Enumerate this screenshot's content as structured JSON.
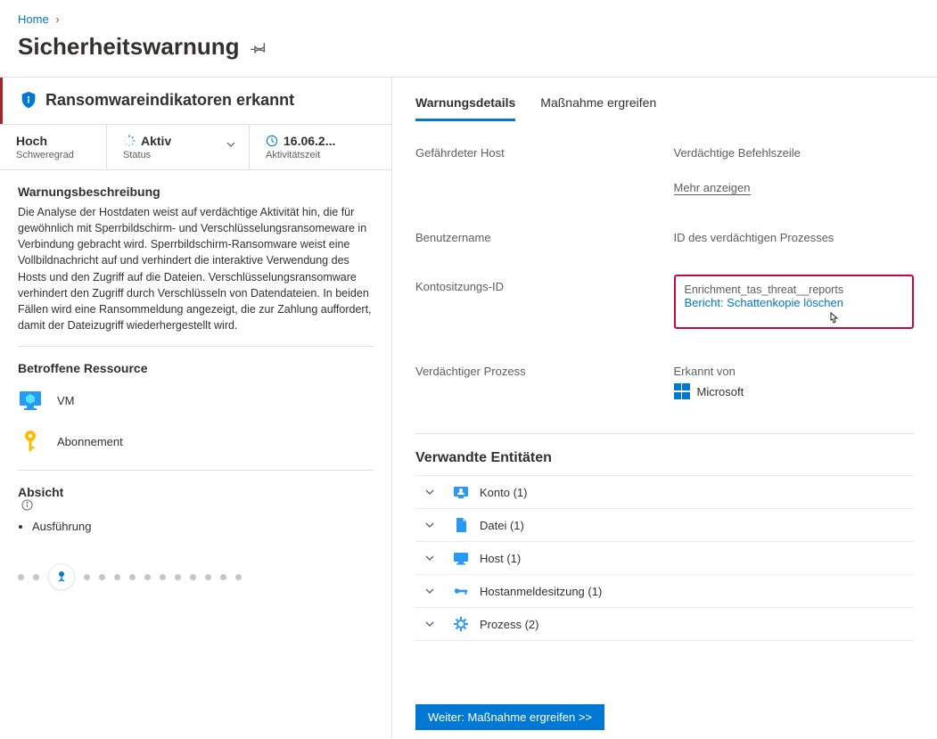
{
  "breadcrumb": {
    "home": "Home"
  },
  "page": {
    "title": "Sicherheitswarnung"
  },
  "alert": {
    "title": "Ransomwareindikatoren erkannt",
    "severity_value": "Hoch",
    "severity_label": "Schweregrad",
    "status_value": "Aktiv",
    "status_label": "Status",
    "time_value": "16.06.2...",
    "time_label": "Aktivitätszeit"
  },
  "description": {
    "title": "Warnungsbeschreibung",
    "text": "Die Analyse der Hostdaten weist auf verdächtige Aktivität hin, die für gewöhnlich mit Sperrbildschirm- und Verschlüsselungsransomeware in Verbindung gebracht wird. Sperrbildschirm-Ransomware weist eine Vollbildnachricht auf und verhindert die interaktive Verwendung des Hosts und den Zugriff auf die Dateien. Verschlüsselungsransomware verhindert den Zugriff durch Verschlüsseln von Datendateien. In beiden Fällen wird eine Ransommeldung angezeigt, die zur Zahlung auffordert, damit der Dateizugriff wiederhergestellt wird."
  },
  "affected": {
    "title": "Betroffene Ressource",
    "items": [
      {
        "label": "VM",
        "icon": "vm"
      },
      {
        "label": "Abonnement",
        "icon": "key"
      }
    ]
  },
  "intent": {
    "title": "Absicht",
    "items": [
      "Ausführung"
    ]
  },
  "tabs": {
    "details": "Warnungsdetails",
    "action": "Maßnahme ergreifen"
  },
  "details": {
    "compromised_host": "Gefährdeter Host",
    "suspicious_cmdline": "Verdächtige Befehlszeile",
    "show_more": "Mehr anzeigen",
    "username": "Benutzername",
    "process_id": "ID des verdächtigen Prozesses",
    "session_id": "Kontositzungs-ID",
    "enrichment_label": "Enrichment_tas_threat__reports",
    "report_link": "Bericht: Schattenkopie löschen",
    "suspicious_process": "Verdächtiger Prozess",
    "detected_by_label": "Erkannt von",
    "detected_by_value": "Microsoft"
  },
  "related": {
    "title": "Verwandte Entitäten",
    "items": [
      {
        "label": "Konto (1)",
        "icon": "account"
      },
      {
        "label": "Datei (1)",
        "icon": "file"
      },
      {
        "label": "Host (1)",
        "icon": "host"
      },
      {
        "label": "Hostanmeldesitzung (1)",
        "icon": "session"
      },
      {
        "label": "Prozess (2)",
        "icon": "process"
      }
    ]
  },
  "footer": {
    "next": "Weiter: Maßnahme ergreifen  >>"
  }
}
